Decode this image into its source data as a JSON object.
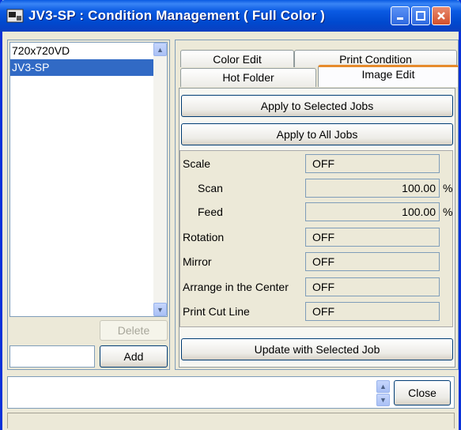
{
  "window": {
    "title": "JV3-SP : Condition Management ( Full Color )",
    "controls": [
      "minimize-icon",
      "maximize-icon",
      "close-icon"
    ]
  },
  "condition_list": {
    "items": [
      {
        "label": "720x720VD",
        "selected": false
      },
      {
        "label": "JV3-SP",
        "selected": true
      }
    ]
  },
  "left_buttons": {
    "delete": "Delete",
    "add": "Add",
    "name_input_value": ""
  },
  "tabs": [
    {
      "label": "Color Edit",
      "active": false
    },
    {
      "label": "Print Condition",
      "active": false
    },
    {
      "label": "Hot Folder",
      "active": false
    },
    {
      "label": "Image Edit",
      "active": true
    }
  ],
  "actions": {
    "apply_selected": "Apply to Selected Jobs",
    "apply_all": "Apply to All Jobs",
    "update_selected": "Update with Selected Job"
  },
  "properties": [
    {
      "label": "Scale",
      "value": "OFF",
      "sub": false
    },
    {
      "label": "Scan",
      "value": "100.00",
      "unit": "%",
      "sub": true
    },
    {
      "label": "Feed",
      "value": "100.00",
      "unit": "%",
      "sub": true
    },
    {
      "label": "Rotation",
      "value": "OFF",
      "sub": false
    },
    {
      "label": "Mirror",
      "value": "OFF",
      "sub": false
    },
    {
      "label": "Arrange in the Center",
      "value": "OFF",
      "sub": false
    },
    {
      "label": "Print Cut Line",
      "value": "OFF",
      "sub": false
    }
  ],
  "footer": {
    "close_label": "Close",
    "message_text": "",
    "status_text": ""
  },
  "colors": {
    "titlebar": "#0a5ae3",
    "selection": "#316ac5",
    "active_tab_accent": "#e68b2c"
  }
}
